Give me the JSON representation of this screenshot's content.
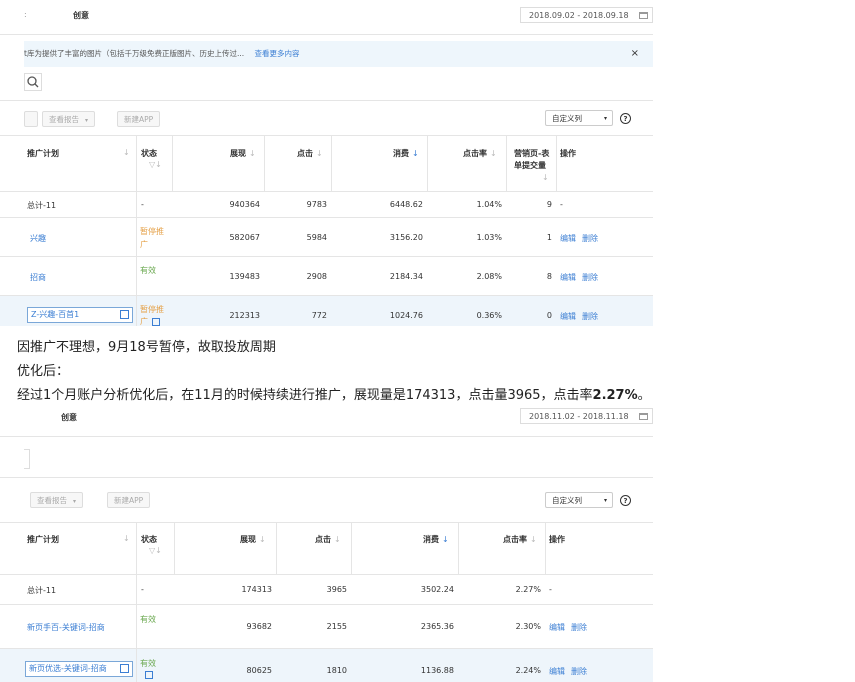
{
  "screenshot1": {
    "tab_partial": ":",
    "tab_label": "创意",
    "date_range": "2018.09.02 - 2018.09.18",
    "notice_text": "t库为提供了丰富的图片（包括千万级免费正版图片、历史上传过...",
    "notice_link": "查看更多内容",
    "close_icon": "×",
    "toolbar": {
      "view_report": "查看报告",
      "new_app": "新建APP",
      "custom_columns": "自定义列",
      "help": "?"
    },
    "headers": {
      "plan": "推广计划",
      "status": "状态",
      "impressions": "展现",
      "clicks": "点击",
      "cost": "消费",
      "ctr": "点击率",
      "conversions_l1": "营销页-表",
      "conversions_l2": "单提交量",
      "actions": "操作"
    },
    "rows": [
      {
        "plan": "总计-11",
        "status": "-",
        "impressions": "940364",
        "clicks": "9783",
        "cost": "6448.62",
        "ctr": "1.04%",
        "conv": "9",
        "actions": "-"
      },
      {
        "plan": "兴趣",
        "status_l1": "暂停推",
        "status_l2": "广",
        "impressions": "582067",
        "clicks": "5984",
        "cost": "3156.20",
        "ctr": "1.03%",
        "conv": "1",
        "edit": "编辑",
        "delete": "删除"
      },
      {
        "plan": "招商",
        "status": "有效",
        "impressions": "139483",
        "clicks": "2908",
        "cost": "2184.34",
        "ctr": "2.08%",
        "conv": "8",
        "edit": "编辑",
        "delete": "删除"
      },
      {
        "plan": "Z-兴趣-百首1",
        "status_l1": "暂停推",
        "status_l2": "广",
        "impressions": "212313",
        "clicks": "772",
        "cost": "1024.76",
        "ctr": "0.36%",
        "conv": "0",
        "edit": "编辑",
        "delete": "删除"
      }
    ]
  },
  "captions": {
    "line1": "因推广不理想，9月18号暂停，故取投放周期",
    "line2": "优化后：",
    "line3_prefix": "经过1个月账户分析优化后，在11月的时候持续进行推广，展现量是174313，点击量3965，点击率",
    "line3_bold": "2.27%",
    "line3_suffix": "。"
  },
  "screenshot2": {
    "tab_label": "创意",
    "date_range": "2018.11.02 - 2018.11.18",
    "toolbar": {
      "view_report": "查看报告",
      "new_app": "新建APP",
      "custom_columns": "自定义列",
      "help": "?"
    },
    "headers": {
      "plan": "推广计划",
      "status": "状态",
      "impressions": "展现",
      "clicks": "点击",
      "cost": "消费",
      "ctr": "点击率",
      "actions": "操作"
    },
    "rows": [
      {
        "plan": "总计-11",
        "status": "-",
        "impressions": "174313",
        "clicks": "3965",
        "cost": "3502.24",
        "ctr": "2.27%",
        "actions": "-"
      },
      {
        "plan": "新页手百-关键词-招商",
        "status": "有效",
        "impressions": "93682",
        "clicks": "2155",
        "cost": "2365.36",
        "ctr": "2.30%",
        "edit": "编辑",
        "delete": "删除"
      },
      {
        "plan": "新页优选-关键词-招商",
        "status": "有效",
        "impressions": "80625",
        "clicks": "1810",
        "cost": "1136.88",
        "ctr": "2.24%",
        "edit": "编辑",
        "delete": "删除"
      }
    ]
  },
  "colors": {
    "link": "#3b7ed3",
    "paused": "#e5a24a",
    "active": "#6aa84f",
    "notice_bg": "#eef6fc"
  }
}
